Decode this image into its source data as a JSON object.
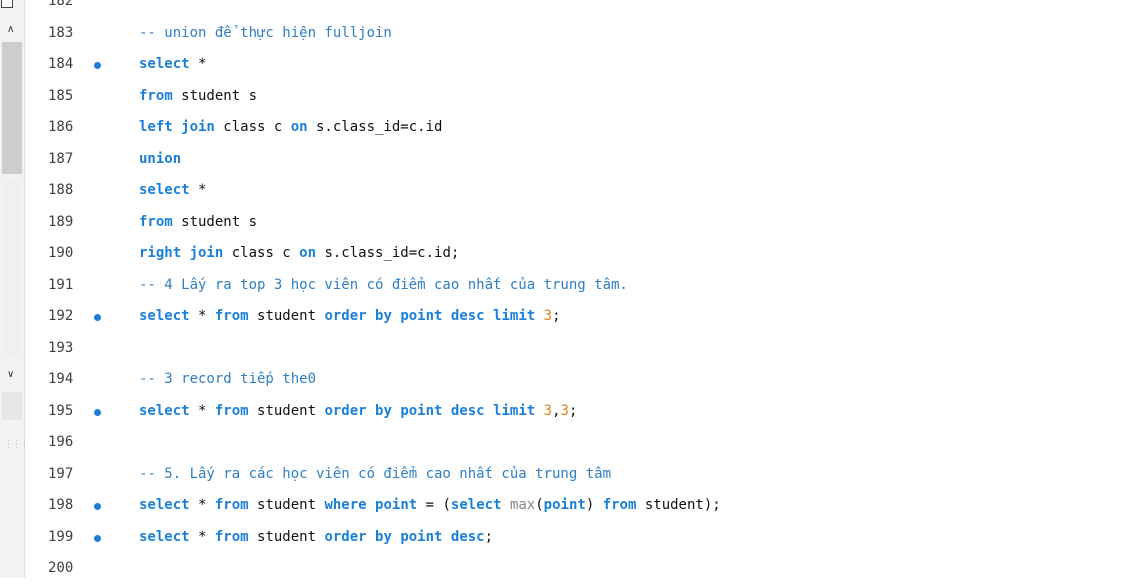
{
  "editor": {
    "lines": [
      {
        "n": "182",
        "breakpoint": false,
        "tokens": []
      },
      {
        "n": "183",
        "breakpoint": false,
        "tokens": [
          {
            "t": "-- union để thực hiện fulljoin",
            "c": "cm"
          }
        ]
      },
      {
        "n": "184",
        "breakpoint": true,
        "tokens": [
          {
            "t": "select",
            "c": "kw"
          },
          {
            "t": " *",
            "c": ""
          }
        ]
      },
      {
        "n": "185",
        "breakpoint": false,
        "tokens": [
          {
            "t": "from",
            "c": "kw"
          },
          {
            "t": " student s",
            "c": ""
          }
        ]
      },
      {
        "n": "186",
        "breakpoint": false,
        "tokens": [
          {
            "t": "left join",
            "c": "kw"
          },
          {
            "t": " class c ",
            "c": ""
          },
          {
            "t": "on",
            "c": "kw"
          },
          {
            "t": " s.class_id=c.id",
            "c": ""
          }
        ]
      },
      {
        "n": "187",
        "breakpoint": false,
        "tokens": [
          {
            "t": "union",
            "c": "kw"
          }
        ]
      },
      {
        "n": "188",
        "breakpoint": false,
        "tokens": [
          {
            "t": "select",
            "c": "kw"
          },
          {
            "t": " *",
            "c": ""
          }
        ]
      },
      {
        "n": "189",
        "breakpoint": false,
        "tokens": [
          {
            "t": "from",
            "c": "kw"
          },
          {
            "t": " student s",
            "c": ""
          }
        ]
      },
      {
        "n": "190",
        "breakpoint": false,
        "tokens": [
          {
            "t": "right join",
            "c": "kw"
          },
          {
            "t": " class c ",
            "c": ""
          },
          {
            "t": "on",
            "c": "kw"
          },
          {
            "t": " s.class_id=c.id;",
            "c": ""
          }
        ]
      },
      {
        "n": "191",
        "breakpoint": false,
        "tokens": [
          {
            "t": "-- 4 Lấy ra top 3 học viên có điểm cao nhất của trung tâm.",
            "c": "cm"
          }
        ]
      },
      {
        "n": "192",
        "breakpoint": true,
        "tokens": [
          {
            "t": "select",
            "c": "kw"
          },
          {
            "t": " * ",
            "c": ""
          },
          {
            "t": "from",
            "c": "kw"
          },
          {
            "t": " student ",
            "c": ""
          },
          {
            "t": "order by",
            "c": "kw"
          },
          {
            "t": " ",
            "c": ""
          },
          {
            "t": "point desc",
            "c": "kw"
          },
          {
            "t": " ",
            "c": ""
          },
          {
            "t": "limit",
            "c": "kw"
          },
          {
            "t": " ",
            "c": ""
          },
          {
            "t": "3",
            "c": "num"
          },
          {
            "t": ";",
            "c": ""
          }
        ]
      },
      {
        "n": "193",
        "breakpoint": false,
        "tokens": []
      },
      {
        "n": "194",
        "breakpoint": false,
        "tokens": [
          {
            "t": "-- 3 record tiếp the0",
            "c": "cm"
          }
        ]
      },
      {
        "n": "195",
        "breakpoint": true,
        "tokens": [
          {
            "t": "select",
            "c": "kw"
          },
          {
            "t": " * ",
            "c": ""
          },
          {
            "t": "from",
            "c": "kw"
          },
          {
            "t": " student ",
            "c": ""
          },
          {
            "t": "order by",
            "c": "kw"
          },
          {
            "t": " ",
            "c": ""
          },
          {
            "t": "point desc",
            "c": "kw"
          },
          {
            "t": " ",
            "c": ""
          },
          {
            "t": "limit",
            "c": "kw"
          },
          {
            "t": " ",
            "c": ""
          },
          {
            "t": "3",
            "c": "num"
          },
          {
            "t": ",",
            "c": ""
          },
          {
            "t": "3",
            "c": "num"
          },
          {
            "t": ";",
            "c": ""
          }
        ]
      },
      {
        "n": "196",
        "breakpoint": false,
        "tokens": []
      },
      {
        "n": "197",
        "breakpoint": false,
        "tokens": [
          {
            "t": "-- 5. Lấy ra các học viên có điểm cao nhất của trung tâm",
            "c": "cm"
          }
        ]
      },
      {
        "n": "198",
        "breakpoint": true,
        "tokens": [
          {
            "t": "select",
            "c": "kw"
          },
          {
            "t": " * ",
            "c": ""
          },
          {
            "t": "from",
            "c": "kw"
          },
          {
            "t": " student ",
            "c": ""
          },
          {
            "t": "where",
            "c": "kw"
          },
          {
            "t": " ",
            "c": ""
          },
          {
            "t": "point",
            "c": "kw"
          },
          {
            "t": " = (",
            "c": ""
          },
          {
            "t": "select",
            "c": "kw"
          },
          {
            "t": " ",
            "c": ""
          },
          {
            "t": "max",
            "c": "fn"
          },
          {
            "t": "(",
            "c": ""
          },
          {
            "t": "point",
            "c": "kw"
          },
          {
            "t": ") ",
            "c": ""
          },
          {
            "t": "from",
            "c": "kw"
          },
          {
            "t": " student);",
            "c": ""
          }
        ]
      },
      {
        "n": "199",
        "breakpoint": true,
        "tokens": [
          {
            "t": "select",
            "c": "kw"
          },
          {
            "t": " * ",
            "c": ""
          },
          {
            "t": "from",
            "c": "kw"
          },
          {
            "t": " student ",
            "c": ""
          },
          {
            "t": "order by",
            "c": "kw"
          },
          {
            "t": " ",
            "c": ""
          },
          {
            "t": "point desc",
            "c": "kw"
          },
          {
            "t": ";",
            "c": ""
          }
        ]
      },
      {
        "n": "200",
        "breakpoint": false,
        "tokens": []
      }
    ]
  },
  "gutter": {
    "scroll_up_icon": "chevron-up-icon",
    "scroll_down_icon": "chevron-down-icon"
  },
  "colors": {
    "keyword": "#1a7fd9",
    "number": "#e0801b",
    "comment": "#2f7fc4",
    "breakpoint": "#1e7bd6"
  }
}
